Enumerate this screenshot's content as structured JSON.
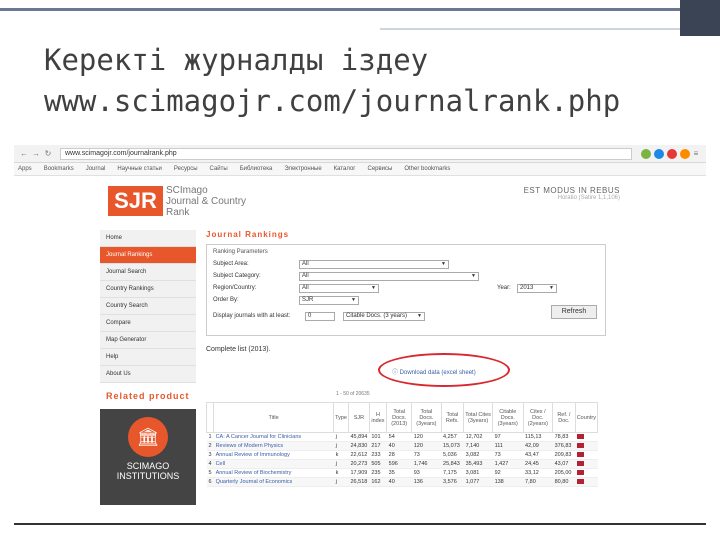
{
  "slide": {
    "title_line1": "Керекті журналды іздеу",
    "title_line2": "www.scimagojr.com/journalrank.php"
  },
  "browser": {
    "url": "www.scimagojr.com/journalrank.php",
    "bookmarks": [
      "Apps",
      "Bookmarks",
      "Journal",
      "Научные статьи",
      "Ресурсы",
      "Сайты",
      "Библиотека",
      "Электронные",
      "Каталог",
      "Сервисы",
      "Other bookmarks"
    ]
  },
  "site": {
    "logo": "SJR",
    "logo_lines": [
      "SCImago",
      "Journal & Country",
      "Rank"
    ],
    "motto": "EST MODUS IN REBUS",
    "motto_sub": "Horatio (Satire 1,1,106)",
    "nav": [
      "Home",
      "Journal Rankings",
      "Journal Search",
      "Country Rankings",
      "Country Search",
      "Compare",
      "Map Generator",
      "Help",
      "About Us"
    ],
    "related_title": "Related product",
    "institutions_label_1": "SCIMAGO",
    "institutions_label_2": "INSTITUTIONS",
    "section_title": "Journal Rankings",
    "params_title": "Ranking Parameters",
    "params": [
      {
        "label": "Subject Area:",
        "value": "All"
      },
      {
        "label": "Subject Category:",
        "value": "All"
      },
      {
        "label": "Region/Country:",
        "value": "All"
      },
      {
        "label": "Order By:",
        "value": "SJR"
      }
    ],
    "year_label": "Year:",
    "year_value": "2013",
    "display_label": "Display journals with at least:",
    "display_value": "0",
    "display_select": "Citable Docs. (3 years)",
    "refresh": "Refresh",
    "complete_list": "Complete list (2013).",
    "download": "Download data (excel sheet)",
    "pager": "1 - 50 of 20635",
    "columns": [
      "",
      "Title",
      "Type",
      "SJR",
      "H index",
      "Total Docs. (2013)",
      "Total Docs. (3years)",
      "Total Refs.",
      "Total Cites (3years)",
      "Citable Docs. (3years)",
      "Cites / Doc. (2years)",
      "Ref. / Doc.",
      "Country"
    ],
    "rows": [
      [
        "1",
        "CA: A Cancer Journal for Clinicians",
        "j",
        "45,894",
        "101",
        "54",
        "120",
        "4,257",
        "12,702",
        "97",
        "115,13",
        "78,83"
      ],
      [
        "2",
        "Reviews of Modern Physics",
        "j",
        "24,830",
        "217",
        "40",
        "120",
        "15,073",
        "7,140",
        "111",
        "42,09",
        "376,83"
      ],
      [
        "3",
        "Annual Review of Immunology",
        "k",
        "22,612",
        "233",
        "28",
        "73",
        "5,036",
        "3,082",
        "73",
        "43,47",
        "209,83"
      ],
      [
        "4",
        "Cell",
        "j",
        "20,273",
        "505",
        "596",
        "1,746",
        "25,843",
        "35,493",
        "1,427",
        "24,45",
        "43,07"
      ],
      [
        "5",
        "Annual Review of Biochemistry",
        "k",
        "17,909",
        "235",
        "35",
        "93",
        "7,175",
        "3,081",
        "92",
        "33,12",
        "205,00"
      ],
      [
        "6",
        "Quarterly Journal of Economics",
        "j",
        "26,518",
        "162",
        "40",
        "136",
        "3,576",
        "1,077",
        "138",
        "7,80",
        "80,80"
      ]
    ]
  }
}
